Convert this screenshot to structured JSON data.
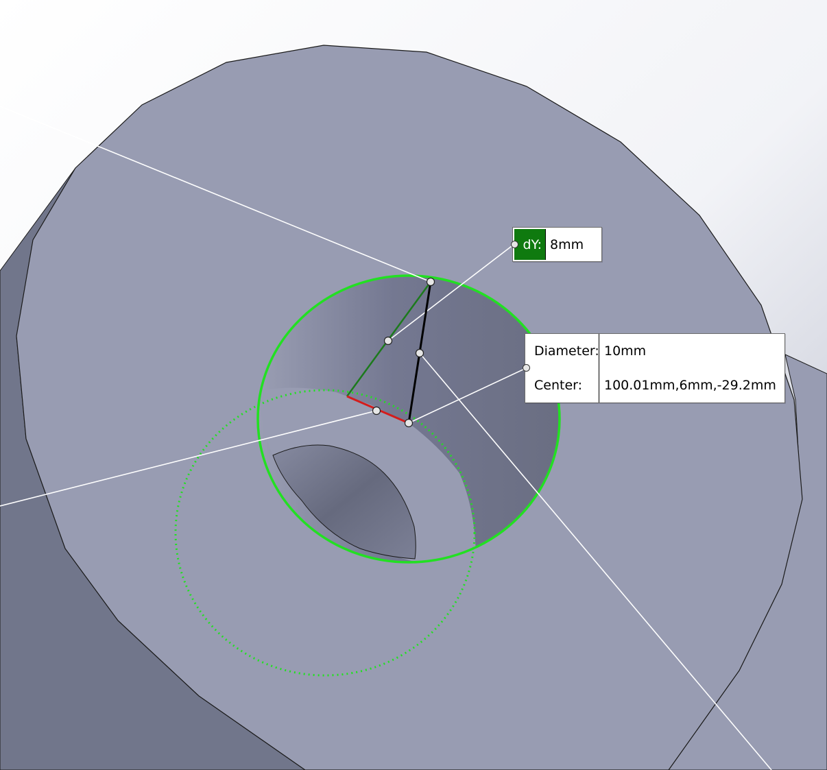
{
  "viewport": {
    "name": "3d-model-viewport"
  },
  "colors": {
    "background_top": "#ffffff",
    "background_right": "#c8ccd9",
    "face": "#989cb2",
    "side_face": "#70758a",
    "hole_wall": "#6f7386",
    "highlight": "#22e022",
    "selected_edge": "#d41c1c",
    "dim_green": "#1c7a1c",
    "label_green": "#0f7a0f",
    "outline": "#1a1a1a"
  },
  "dimension_callout": {
    "label": "dY:",
    "value": "8mm"
  },
  "properties_callout": {
    "diameter_label": "Diameter:",
    "diameter_value": "10mm",
    "center_label": "Center:",
    "center_value": "100.01mm,6mm,-29.2mm"
  }
}
